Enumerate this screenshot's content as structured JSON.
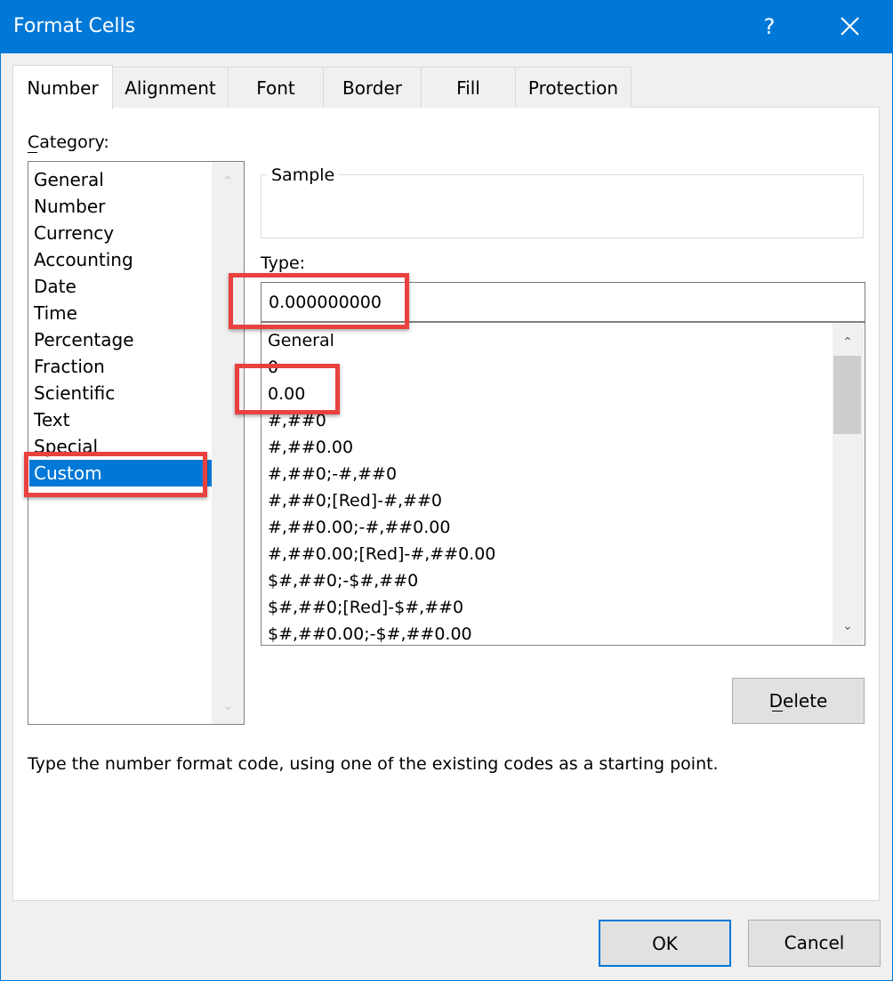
{
  "window": {
    "title": "Format Cells",
    "help_label": "?",
    "close_icon": "close-icon",
    "accent_color": "#0078d7"
  },
  "tabs": [
    {
      "label": "Number",
      "active": true
    },
    {
      "label": "Alignment",
      "active": false
    },
    {
      "label": "Font",
      "active": false
    },
    {
      "label": "Border",
      "active": false
    },
    {
      "label": "Fill",
      "active": false
    },
    {
      "label": "Protection",
      "active": false
    }
  ],
  "category": {
    "label": "Category:",
    "selected": "Custom",
    "items": [
      "General",
      "Number",
      "Currency",
      "Accounting",
      "Date",
      "Time",
      "Percentage",
      "Fraction",
      "Scientific",
      "Text",
      "Special",
      "Custom"
    ]
  },
  "sample": {
    "label": "Sample",
    "value": ""
  },
  "type": {
    "label": "Type:",
    "value": "0.000000000",
    "formats": [
      "General",
      "0",
      "0.00",
      "#,##0",
      "#,##0.00",
      "#,##0;-#,##0",
      "#,##0;[Red]-#,##0",
      "#,##0.00;-#,##0.00",
      "#,##0.00;[Red]-#,##0.00",
      "$#,##0;-$#,##0",
      "$#,##0;[Red]-$#,##0",
      "$#,##0.00;-$#,##0.00"
    ]
  },
  "buttons": {
    "delete": "Delete",
    "ok": "OK",
    "cancel": "Cancel"
  },
  "hint": "Type the number format code, using one of the existing codes as a starting point.",
  "annotation_color": "#e8413f"
}
